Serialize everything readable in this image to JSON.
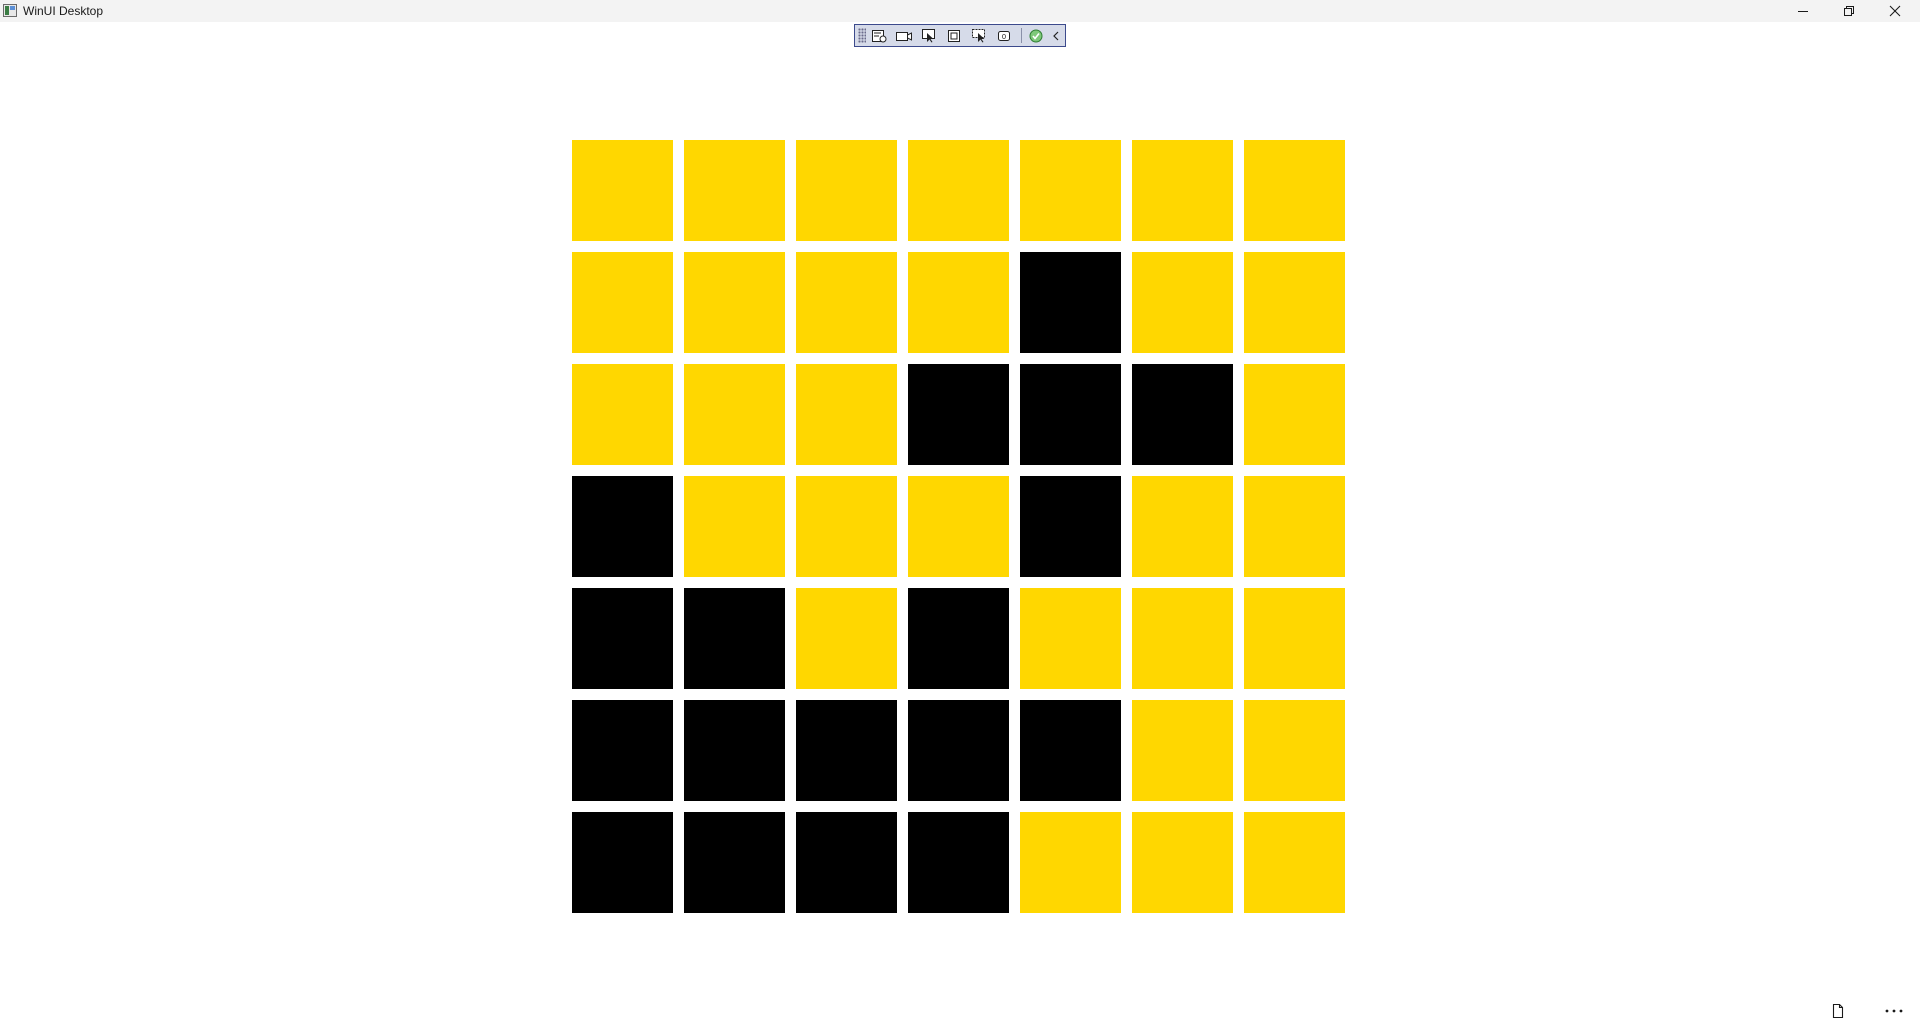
{
  "window": {
    "title": "WinUI Desktop"
  },
  "caption_buttons": [
    "minimize",
    "restore",
    "close"
  ],
  "debug_toolbar": {
    "buttons": [
      "live-visual-tree-icon",
      "record-icon",
      "select-element-icon",
      "display-layout-adorners-icon",
      "track-focus-icon",
      "binding-failures-icon",
      "accessibility-check-icon",
      "collapse-icon"
    ]
  },
  "colors": {
    "yellow": "#FFD700",
    "black": "#000000"
  },
  "grid": {
    "rows": [
      [
        "yellow",
        "yellow",
        "yellow",
        "yellow",
        "yellow",
        "yellow",
        "yellow"
      ],
      [
        "yellow",
        "yellow",
        "yellow",
        "yellow",
        "black",
        "yellow",
        "yellow"
      ],
      [
        "yellow",
        "yellow",
        "yellow",
        "black",
        "black",
        "black",
        "yellow"
      ],
      [
        "black",
        "yellow",
        "yellow",
        "yellow",
        "black",
        "yellow",
        "yellow"
      ],
      [
        "black",
        "black",
        "yellow",
        "black",
        "yellow",
        "yellow",
        "yellow"
      ],
      [
        "black",
        "black",
        "black",
        "black",
        "black",
        "yellow",
        "yellow"
      ],
      [
        "black",
        "black",
        "black",
        "black",
        "yellow",
        "yellow",
        "yellow"
      ]
    ]
  },
  "command_bar": {
    "buttons": [
      "document-icon",
      "more-icon"
    ]
  }
}
